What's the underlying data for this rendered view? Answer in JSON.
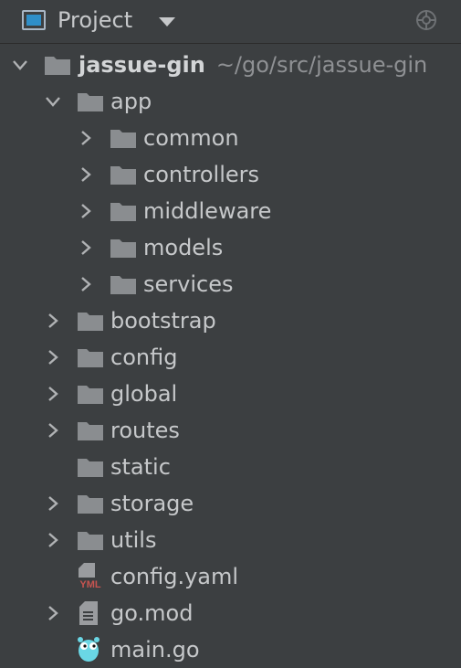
{
  "header": {
    "title": "Project",
    "icons": [
      "project-window-icon",
      "dropdown-caret-icon",
      "locate-target-icon"
    ]
  },
  "tree": {
    "root": {
      "name": "jassue-gin",
      "path": "~/go/src/jassue-gin",
      "expanded": true
    },
    "items": [
      {
        "name": "app",
        "kind": "folder",
        "expanded": true
      },
      {
        "name": "common",
        "kind": "folder",
        "expanded": false
      },
      {
        "name": "controllers",
        "kind": "folder",
        "expanded": false
      },
      {
        "name": "middleware",
        "kind": "folder",
        "expanded": false
      },
      {
        "name": "models",
        "kind": "folder",
        "expanded": false
      },
      {
        "name": "services",
        "kind": "folder",
        "expanded": false
      },
      {
        "name": "bootstrap",
        "kind": "folder",
        "expanded": false
      },
      {
        "name": "config",
        "kind": "folder",
        "expanded": false
      },
      {
        "name": "global",
        "kind": "folder",
        "expanded": false
      },
      {
        "name": "routes",
        "kind": "folder",
        "expanded": false
      },
      {
        "name": "static",
        "kind": "folder",
        "expanded": null
      },
      {
        "name": "storage",
        "kind": "folder",
        "expanded": false
      },
      {
        "name": "utils",
        "kind": "folder",
        "expanded": false
      },
      {
        "name": "config.yaml",
        "kind": "yaml-file",
        "badge": "YML"
      },
      {
        "name": "go.mod",
        "kind": "mod-file",
        "expanded": false
      },
      {
        "name": "main.go",
        "kind": "go-file"
      }
    ]
  },
  "colors": {
    "background": "#3c3f41",
    "text": "#c6c8ca",
    "folder": "#8a8d90",
    "accent": "#2f8fc9",
    "yaml_badge": "#c75450"
  }
}
